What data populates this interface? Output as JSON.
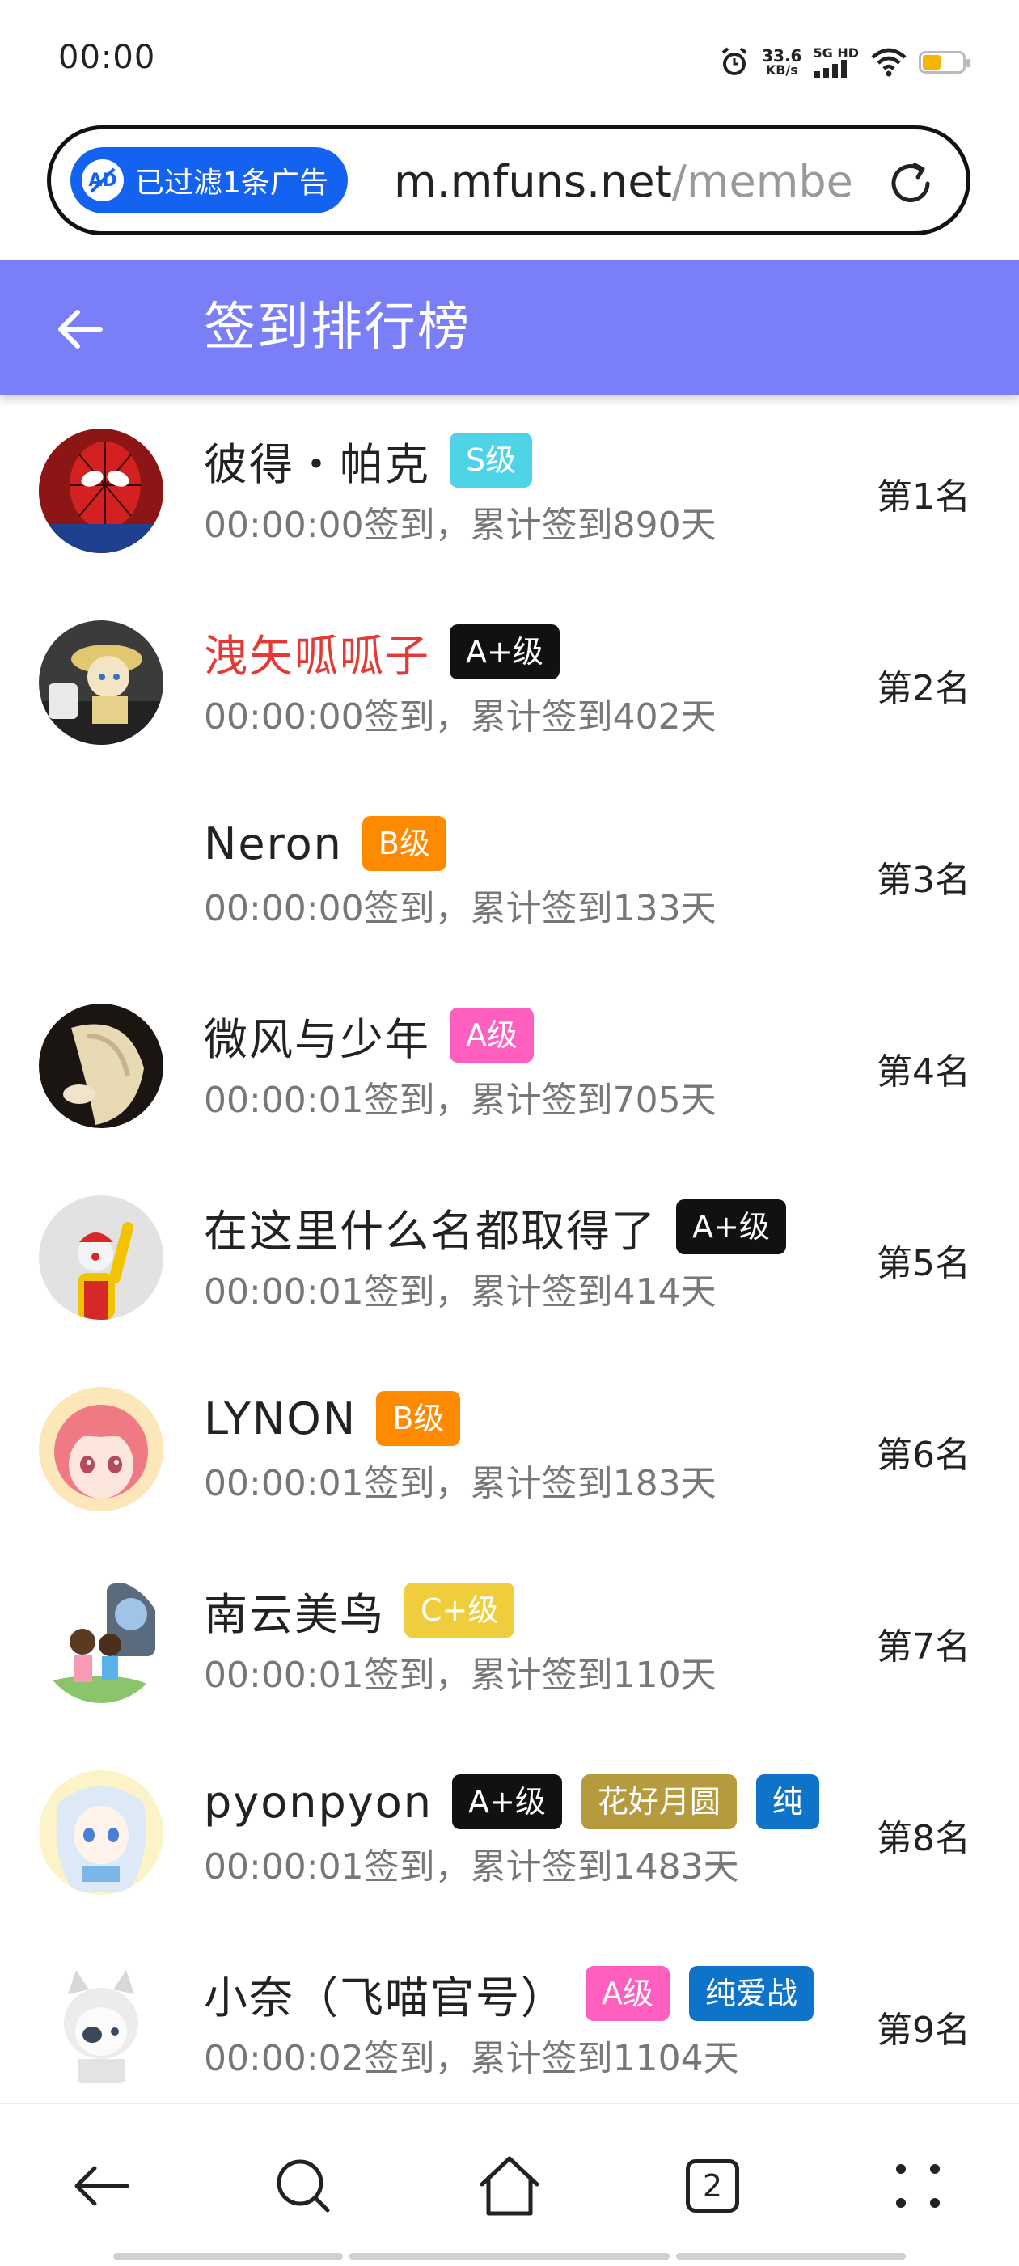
{
  "status_bar": {
    "time": "00:00",
    "speed_value": "33.6",
    "speed_unit": "KB/s",
    "network": "5G HD"
  },
  "browser": {
    "ad_filter_label": "已过滤1条广告",
    "url_host": "m.mfuns.net",
    "url_path": "/membe"
  },
  "header": {
    "title": "签到排行榜"
  },
  "rows": [
    {
      "name": "彼得・帕克",
      "name_color": "#222222",
      "badges": [
        {
          "text": "S级",
          "color": "#4fd3e6"
        }
      ],
      "sub": "00:00:00签到，累计签到890天",
      "rank": "第1名",
      "avatar": "spiderman-avatar"
    },
    {
      "name": "洩矢呱呱子",
      "name_color": "#e53935",
      "badges": [
        {
          "text": "A+级",
          "color": "#111111"
        }
      ],
      "sub": "00:00:00签到，累计签到402天",
      "rank": "第2名",
      "avatar": "figure-avatar"
    },
    {
      "name": "Neron",
      "name_color": "#222222",
      "badges": [
        {
          "text": "B级",
          "color": "#ff8a00"
        }
      ],
      "sub": "00:00:00签到，累计签到133天",
      "rank": "第3名",
      "avatar": ""
    },
    {
      "name": "微风与少年",
      "name_color": "#222222",
      "badges": [
        {
          "text": "A级",
          "color": "#ff5fbf"
        }
      ],
      "sub": "00:00:01签到，累计签到705天",
      "rank": "第4名",
      "avatar": "blonde-avatar"
    },
    {
      "name": "在这里什么名都取得了",
      "name_color": "#222222",
      "badges": [
        {
          "text": "A+级",
          "color": "#111111"
        }
      ],
      "sub": "00:00:01签到，累计签到414天",
      "rank": "第5名",
      "avatar": "clown-avatar"
    },
    {
      "name": "LYNON",
      "name_color": "#222222",
      "badges": [
        {
          "text": "B级",
          "color": "#ff8a00"
        }
      ],
      "sub": "00:00:01签到，累计签到183天",
      "rank": "第6名",
      "avatar": "anime-girl-avatar"
    },
    {
      "name": "南云美鸟",
      "name_color": "#222222",
      "badges": [
        {
          "text": "C+级",
          "color": "#f0cd3c"
        }
      ],
      "sub": "00:00:01签到，累计签到110天",
      "rank": "第7名",
      "avatar": "kids-avatar"
    },
    {
      "name": "pyonpyon",
      "name_color": "#222222",
      "badges": [
        {
          "text": "A+级",
          "color": "#111111"
        },
        {
          "text": "花好月圆",
          "color": "#b59a3e"
        },
        {
          "text": "纯",
          "color": "#0d74c9"
        }
      ],
      "sub": "00:00:01签到，累计签到1483天",
      "rank": "第8名",
      "avatar": "white-hair-avatar"
    },
    {
      "name": "小奈（飞喵官号）",
      "name_color": "#222222",
      "badges": [
        {
          "text": "A级",
          "color": "#ff5fbf"
        },
        {
          "text": "纯爱战",
          "color": "#0d74c9"
        }
      ],
      "sub": "00:00:02签到，累计签到1104天",
      "rank": "第9名",
      "avatar": "cat-girl-avatar"
    }
  ],
  "bottom_nav": {
    "tab_count": "2"
  }
}
